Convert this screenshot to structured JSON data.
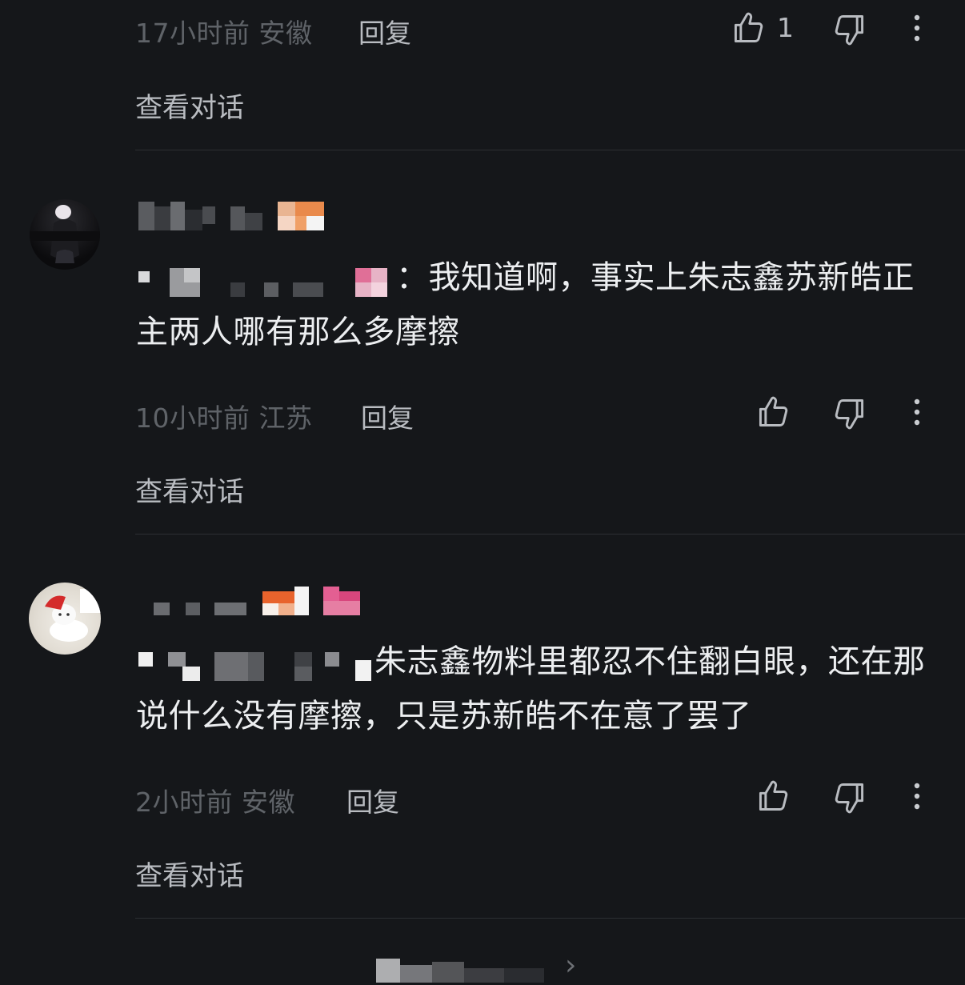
{
  "comments": [
    {
      "time_location": "17小时前 安徽",
      "reply_label": "回复",
      "like_count": "1",
      "view_conversation": "查看对话"
    },
    {
      "avatar_icon": "avatar-image",
      "text_prefix": "：",
      "text": "我知道啊，事实上朱志鑫苏新皓正主两人哪有那么多摩擦",
      "time_location": "10小时前 江苏",
      "reply_label": "回复",
      "like_count": "",
      "view_conversation": "查看对话"
    },
    {
      "avatar_icon": "avatar-image",
      "text": "朱志鑫物料里都忍不住翻白眼，还在那说什么没有摩擦，只是苏新皓不在意了罢了",
      "time_location": "2小时前 安徽",
      "reply_label": "回复",
      "like_count": "",
      "view_conversation": "查看对话"
    }
  ],
  "icons": {
    "like": "thumbs-up-icon",
    "dislike": "thumbs-down-icon",
    "more": "more-vertical-icon",
    "next": "chevron-right-icon"
  },
  "bottom": {
    "arrow": "›"
  },
  "colors": {
    "background": "#15171a",
    "text_primary": "#eceef0",
    "text_secondary": "#b9bcc1",
    "text_muted": "#5f6368",
    "divider": "#2c2f33"
  }
}
